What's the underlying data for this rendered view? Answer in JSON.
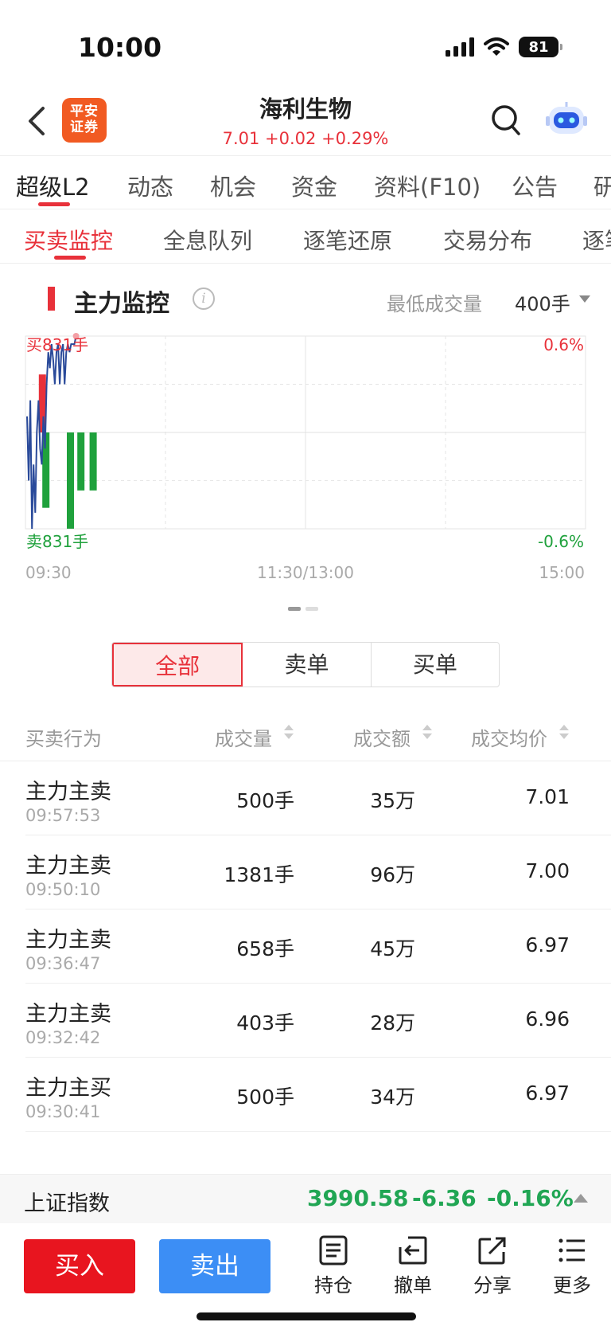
{
  "status": {
    "time": "10:00",
    "battery": "81"
  },
  "header": {
    "logo_line1": "平安",
    "logo_line2": "证券",
    "title": "海利生物",
    "quote": "7.01 +0.02 +0.29%"
  },
  "main_tabs": [
    "超级L2",
    "动态",
    "机会",
    "资金",
    "资料(F10)",
    "公告",
    "研"
  ],
  "sub_tabs": [
    "买卖监控",
    "全息队列",
    "逐笔还原",
    "交易分布",
    "逐笔"
  ],
  "monitor": {
    "title": "主力监控",
    "min_volume_label": "最低成交量",
    "min_volume_value": "400手"
  },
  "chart_data": {
    "type": "bar",
    "buy_label": "买831手",
    "sell_label": "卖831手",
    "y_top_label": "0.6%",
    "y_bottom_label": "-0.6%",
    "ylim": [
      -0.6,
      0.6
    ],
    "x_ticks": [
      "09:30",
      "11:30/13:00",
      "15:00"
    ],
    "bars": [
      {
        "time_index": 8,
        "value": 500,
        "side": "buy"
      },
      {
        "time_index": 12,
        "value": -650,
        "side": "sell"
      },
      {
        "time_index": 40,
        "value": -830,
        "side": "sell"
      },
      {
        "time_index": 52,
        "value": -500,
        "side": "sell"
      },
      {
        "time_index": 66,
        "value": -500,
        "side": "sell"
      }
    ],
    "bar_scale_max": 831,
    "price_line_pct": [
      0.1,
      -0.3,
      0.2,
      -0.6,
      -0.2,
      -0.5,
      0.0,
      0.2,
      -0.1,
      -0.2,
      0.1,
      -0.1,
      0.3,
      0.5,
      0.4,
      0.55,
      0.45,
      0.3,
      0.5,
      0.55,
      0.3,
      0.5,
      0.55,
      0.3,
      0.5,
      0.55,
      0.5,
      0.55,
      0.55,
      0.55,
      0.6
    ],
    "price_line_color": "#2a4a9a",
    "buy_color": "#e8313a",
    "sell_color": "#1fa13c",
    "total_minutes": 240,
    "current_minute": 30
  },
  "filter": {
    "options": [
      "全部",
      "卖单",
      "买单"
    ],
    "selected": "全部"
  },
  "table": {
    "headers": [
      "买卖行为",
      "成交量",
      "成交额",
      "成交均价"
    ],
    "rows": [
      {
        "action": "主力主卖",
        "time": "09:57:53",
        "volume": "500手",
        "amount": "35万",
        "avg": "7.01"
      },
      {
        "action": "主力主卖",
        "time": "09:50:10",
        "volume": "1381手",
        "amount": "96万",
        "avg": "7.00"
      },
      {
        "action": "主力主卖",
        "time": "09:36:47",
        "volume": "658手",
        "amount": "45万",
        "avg": "6.97"
      },
      {
        "action": "主力主卖",
        "time": "09:32:42",
        "volume": "403手",
        "amount": "28万",
        "avg": "6.96"
      },
      {
        "action": "主力主买",
        "time": "09:30:41",
        "volume": "500手",
        "amount": "34万",
        "avg": "6.97"
      }
    ]
  },
  "index": {
    "name": "上证指数",
    "value": "3990.58",
    "change": "-6.36",
    "percent": "-0.16%"
  },
  "bottom": {
    "buy": "买入",
    "sell": "卖出",
    "tools": [
      "持仓",
      "撤单",
      "分享",
      "更多"
    ]
  }
}
